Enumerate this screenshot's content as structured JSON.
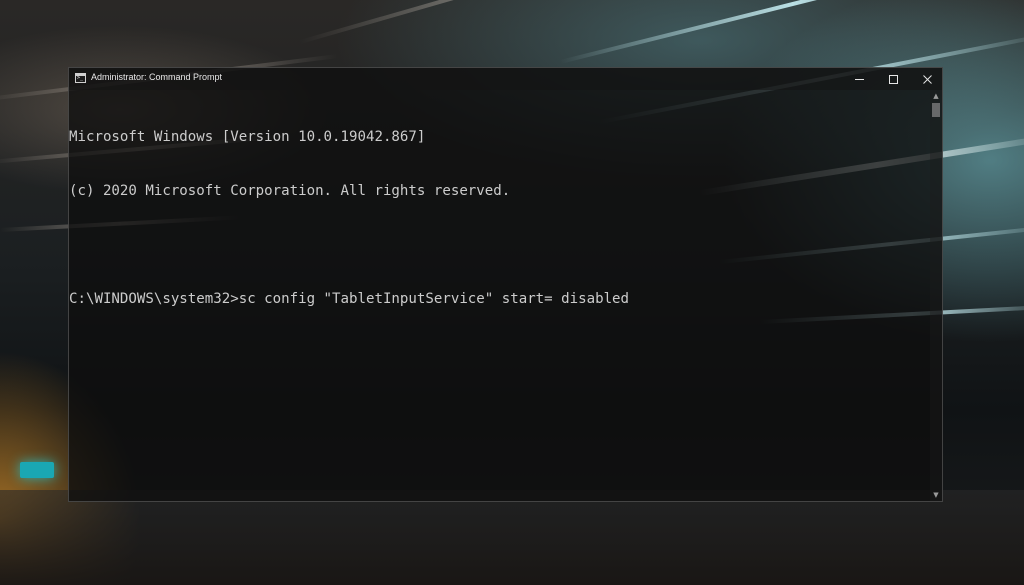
{
  "window": {
    "title": "Administrator: Command Prompt",
    "icon": "command-prompt-icon",
    "controls": {
      "minimize_icon": "minimize-icon",
      "maximize_icon": "maximize-icon",
      "close_icon": "close-icon"
    }
  },
  "console": {
    "lines": [
      "Microsoft Windows [Version 10.0.19042.867]",
      "(c) 2020 Microsoft Corporation. All rights reserved.",
      "",
      "C:\\WINDOWS\\system32>sc config \"TabletInputService\" start= disabled"
    ],
    "text_color": "#cccccc"
  },
  "scrollbar": {
    "up_icon": "scroll-up-arrow-icon",
    "down_icon": "scroll-down-arrow-icon"
  }
}
